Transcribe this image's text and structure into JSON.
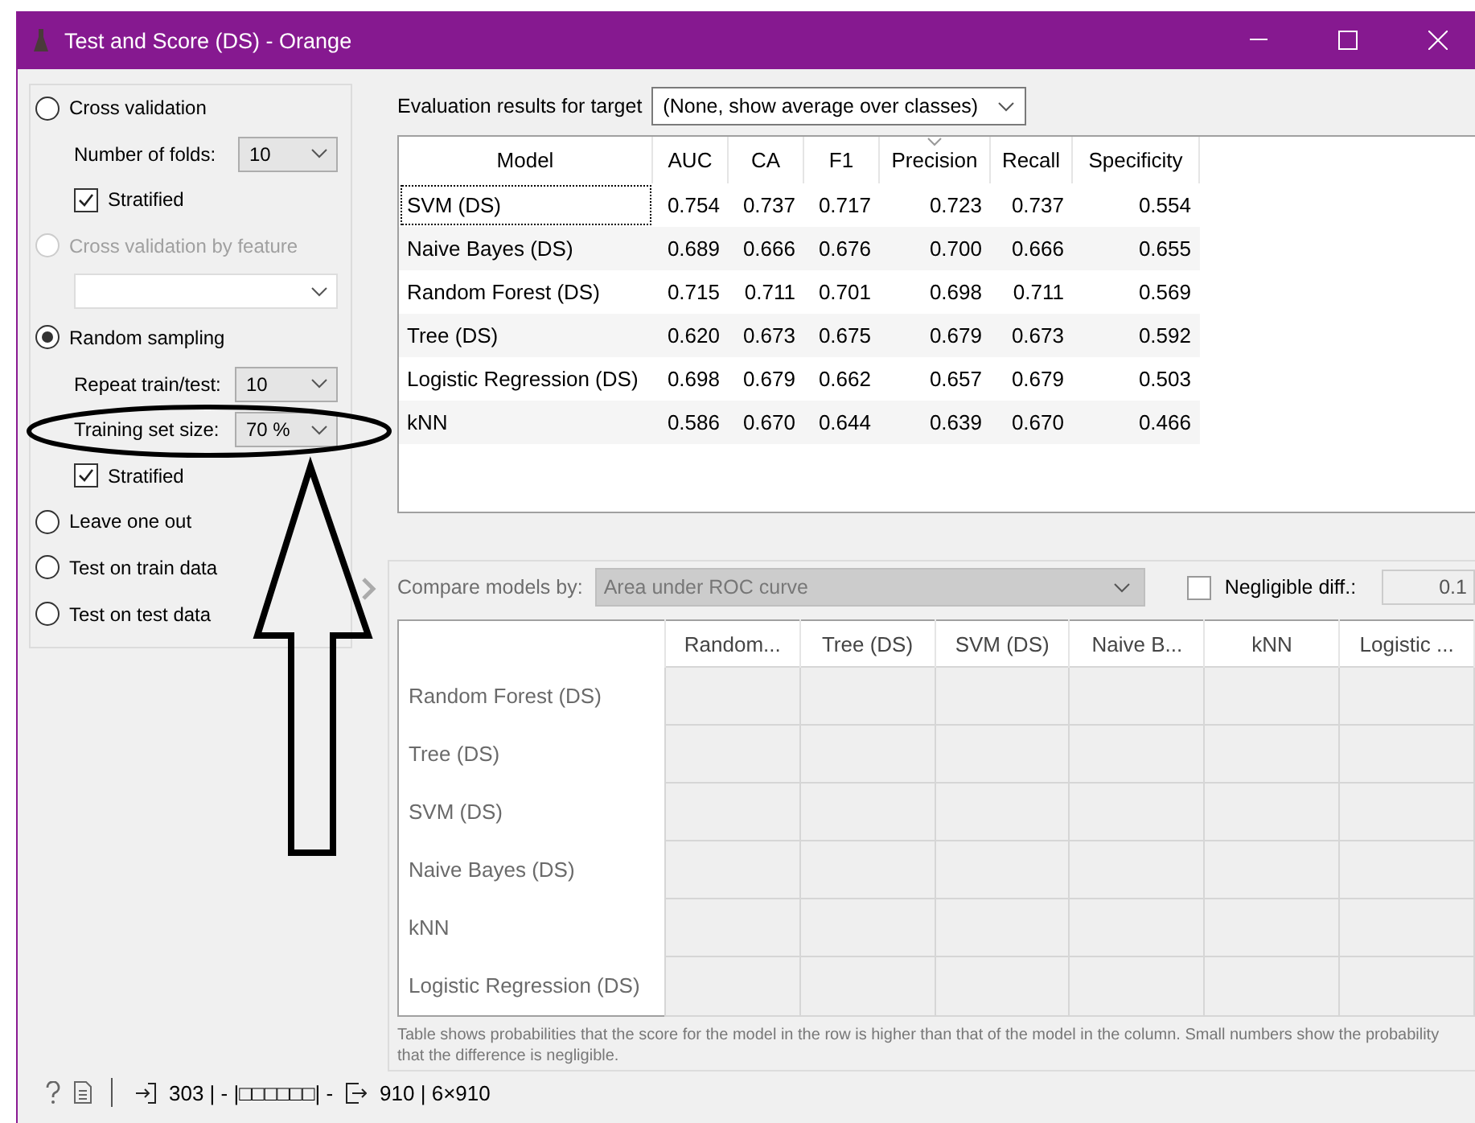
{
  "window": {
    "title": "Test and Score (DS) - Orange"
  },
  "sampling": [
    {
      "kind": "radio",
      "label": "Cross validation",
      "selected": false,
      "disabled": false
    },
    {
      "kind": "combo",
      "label": "Number of folds:",
      "value": "10"
    },
    {
      "kind": "checkbox",
      "label": "Stratified",
      "checked": true
    },
    {
      "kind": "radio",
      "label": "Cross validation by feature",
      "selected": false,
      "disabled": true
    },
    {
      "kind": "combo"
    },
    {
      "kind": "radio",
      "label": "Random sampling",
      "selected": true,
      "disabled": false
    },
    {
      "kind": "combo",
      "label": "Repeat train/test:",
      "value": "10"
    },
    {
      "kind": "combo",
      "label": "Training set size:",
      "value": "70 %"
    },
    {
      "kind": "checkbox",
      "label": "Stratified",
      "checked": true
    },
    {
      "kind": "radio",
      "label": "Leave one out",
      "selected": false,
      "disabled": false
    },
    {
      "kind": "radio",
      "label": "Test on train data",
      "selected": false,
      "disabled": false
    },
    {
      "kind": "radio",
      "label": "Test on test data",
      "selected": false,
      "disabled": false
    }
  ],
  "target": {
    "label": "Evaluation results for target",
    "value": "(None, show average over classes)"
  },
  "results": {
    "columns": [
      {
        "label": "Model",
        "sorted": false
      },
      {
        "label": "AUC",
        "sorted": false
      },
      {
        "label": "CA",
        "sorted": false
      },
      {
        "label": "F1",
        "sorted": false
      },
      {
        "label": "Precision",
        "sorted": true
      },
      {
        "label": "Recall",
        "sorted": false
      },
      {
        "label": "Specificity",
        "sorted": false
      }
    ],
    "rows": [
      {
        "focused": true,
        "cells": [
          "SVM (DS)",
          "0.754",
          "0.737",
          "0.717",
          "0.723",
          "0.737",
          "0.554"
        ]
      },
      {
        "focused": false,
        "cells": [
          "Naive Bayes (DS)",
          "0.689",
          "0.666",
          "0.676",
          "0.700",
          "0.666",
          "0.655"
        ]
      },
      {
        "focused": false,
        "cells": [
          "Random Forest (DS)",
          "0.715",
          "0.711",
          "0.701",
          "0.698",
          "0.711",
          "0.569"
        ]
      },
      {
        "focused": false,
        "cells": [
          "Tree (DS)",
          "0.620",
          "0.673",
          "0.675",
          "0.679",
          "0.673",
          "0.592"
        ]
      },
      {
        "focused": false,
        "cells": [
          "Logistic Regression (DS)",
          "0.698",
          "0.679",
          "0.662",
          "0.657",
          "0.679",
          "0.503"
        ]
      },
      {
        "focused": false,
        "cells": [
          "kNN",
          "0.586",
          "0.670",
          "0.644",
          "0.639",
          "0.670",
          "0.466"
        ]
      }
    ]
  },
  "comparison": {
    "label": "Compare models by:",
    "value": "Area under ROC curve",
    "disabled": true,
    "negligible": {
      "label": "Negligible diff.:",
      "checked": false,
      "value": "0.1"
    },
    "columns": [
      "Random...",
      "Tree (DS)",
      "SVM (DS)",
      "Naive B...",
      "kNN",
      "Logistic ..."
    ],
    "rows": [
      "Random Forest (DS)",
      "Tree (DS)",
      "SVM (DS)",
      "Naive Bayes (DS)",
      "kNN",
      "Logistic Regression (DS)"
    ],
    "note": "Table shows probabilities that the score for the model in the row is higher than that of the model in the column. Small numbers show the probability that the difference is negligible."
  },
  "status_bar": {
    "input": "303 | - |□□□□□□| -",
    "output": "910 | 6×910"
  }
}
